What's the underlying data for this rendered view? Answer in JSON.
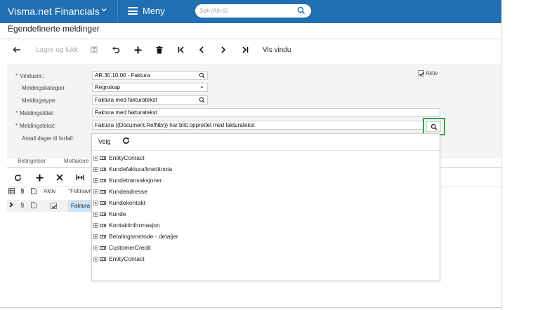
{
  "header": {
    "brand": "Visma.net Financials",
    "menu_label": "Meny",
    "search_placeholder": "Søk (Alt+S)"
  },
  "page": {
    "title": "Egendefinerte meldinger"
  },
  "toolbar": {
    "save_close_label": "Lagre og lukk",
    "show_window_label": "Vis vindu"
  },
  "form": {
    "window_no": {
      "label": "Vindusnr.:",
      "value": "AR.30.10.00 - Faktura"
    },
    "category": {
      "label": "Meldingskategori:",
      "value": "Regnskap"
    },
    "type": {
      "label": "Meldingstype:",
      "value": "Faktura med fakturatekst"
    },
    "title": {
      "label": "Meldingstittel:",
      "value": "Faktura med fakturatekst"
    },
    "text": {
      "label": "Meldingstekst:",
      "value": "Faktura ((Document.RefNbr)) har blitt opprettet med fakturatekst"
    },
    "days_to_due": {
      "label": "Antall dager til forfall:"
    },
    "active": {
      "label": "Aktiv",
      "checked": true
    }
  },
  "tabs": [
    "Betingelser",
    "Mottakere"
  ],
  "grid": {
    "columns": {
      "active": "Aktiv",
      "field_name": "Feltnavn"
    },
    "row": {
      "field_name": "Faktura"
    }
  },
  "lookup": {
    "select_label": "Velg",
    "items": [
      "EntityContact",
      "Kundefaktura/kreditnota",
      "Kundetransaksjoner",
      "Kundeadresse",
      "Kundekontakt",
      "Kunde",
      "Kontaktinformasjon",
      "Betalingsmetode - detaljer",
      "CustomerCredit",
      "EntityContact"
    ]
  },
  "colors": {
    "header_bg": "#1f6fb2",
    "highlight": "#2ca646",
    "row_selected": "#cfe4f6"
  }
}
